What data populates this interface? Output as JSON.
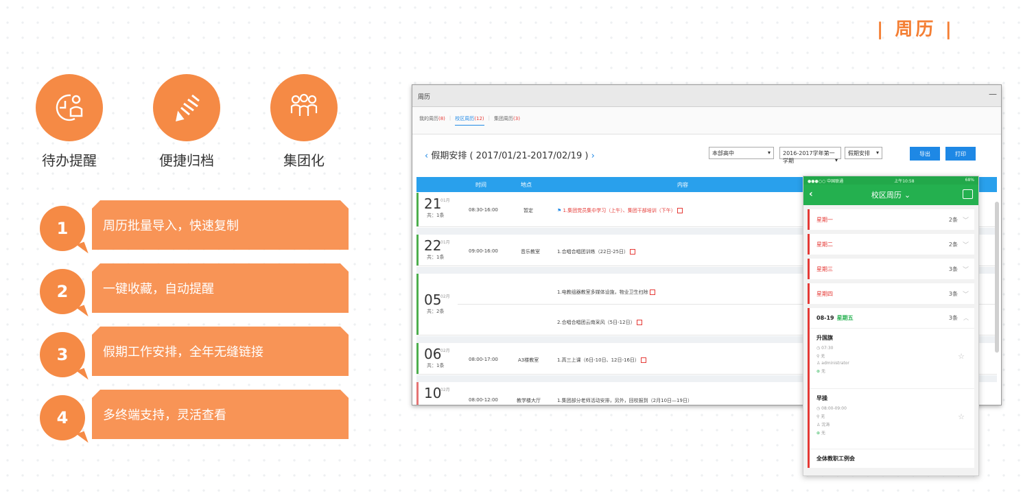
{
  "page_title": "| 周历 |",
  "features": [
    {
      "label": "待办提醒",
      "icon": "clock-person-icon"
    },
    {
      "label": "便捷归档",
      "icon": "archive-icon"
    },
    {
      "label": "集团化",
      "icon": "group-icon"
    }
  ],
  "bullets": [
    {
      "num": "1",
      "text": "周历批量导入，快速复制"
    },
    {
      "num": "2",
      "text": "一键收藏，自动提醒"
    },
    {
      "num": "3",
      "text": "假期工作安排，全年无缝链接"
    },
    {
      "num": "4",
      "text": "多终端支持，灵活查看"
    }
  ],
  "window": {
    "title": "周历",
    "tabs": [
      {
        "label": "我的周历",
        "count": "(8)"
      },
      {
        "label": "校区周历",
        "count": "(12)"
      },
      {
        "label": "集团周历",
        "count": "(3)"
      }
    ],
    "range_text": "假期安排 ( 2017/01/21-2017/02/19 )",
    "prev": "‹",
    "next": "›",
    "select_campus": "本部高中",
    "select_term": "2016-2017学年第一学期",
    "select_type": "假期安排",
    "export_btn": "导出",
    "print_btn": "打印",
    "columns": {
      "time": "时间",
      "place": "地点",
      "content": "内容"
    },
    "rows": [
      {
        "day": "21",
        "month": "01月",
        "total": "共：1条",
        "time": "08:30-16:00",
        "place": "暂定",
        "content": "1.集团党员集中学习（上午）、集团干部培训（下午）"
      },
      {
        "day": "22",
        "month": "01月",
        "total": "共：1条",
        "time": "09:00-16:00",
        "place": "音乐教室",
        "content": "1.合唱合唱团训练（22日-25日）"
      },
      {
        "day": "05",
        "month": "02月",
        "total": "共：2条",
        "time": "",
        "place": "",
        "content": "1.电教组器教室多媒体设施，物业卫生扫除",
        "content2": "2.合唱合唱团云南采风（5日-12日）"
      },
      {
        "day": "06",
        "month": "02月",
        "total": "共：1条",
        "time": "08:00-17:00",
        "place": "A3楼教室",
        "content": "1.高三上课（6日-10日、12日-16日）"
      },
      {
        "day": "10",
        "month": "02月",
        "total": "",
        "time": "08:00-12:00",
        "place": "教学楼大厅",
        "content": "1.集团部分老师活动安排，另外，回校报到（2月10日—19日）"
      }
    ]
  },
  "phone": {
    "status_left": "●●●○○ 中国联通",
    "status_mid": "上午10:58",
    "status_right": "68%",
    "title": "校区周历",
    "title_chevron": "⌄",
    "days": [
      {
        "label": "星期一",
        "count": "2条"
      },
      {
        "label": "星期二",
        "count": "2条"
      },
      {
        "label": "星期三",
        "count": "3条"
      },
      {
        "label": "星期四",
        "count": "3条"
      }
    ],
    "open_day": {
      "date": "08-19",
      "label": "星期五",
      "count": "3条"
    },
    "events": [
      {
        "title": "升国旗",
        "time": "07:30",
        "place": "无",
        "person": "administrator",
        "note": "无"
      },
      {
        "title": "早操",
        "time": "08:00-09:00",
        "place": "无",
        "person": "沈涛",
        "note": "无"
      }
    ],
    "next_event": "全体教职工例会"
  }
}
